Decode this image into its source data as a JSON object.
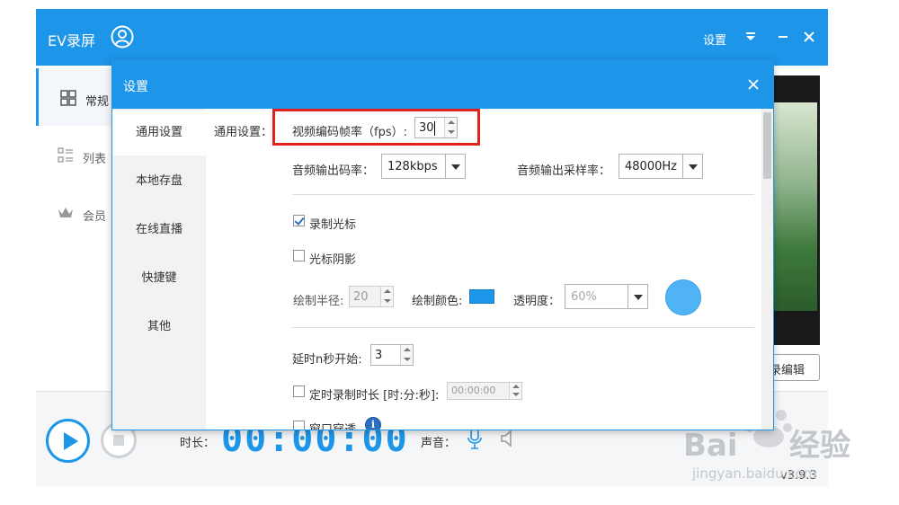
{
  "app": {
    "title": "EV录屏",
    "settings_label": "设置",
    "sidebar": [
      {
        "label": "常规",
        "icon": "grid-icon",
        "active": true
      },
      {
        "label": "列表",
        "icon": "list-icon",
        "active": false
      },
      {
        "label": "会员",
        "icon": "crown-icon",
        "active": false
      }
    ],
    "edit_button_label": "录编辑",
    "bottom": {
      "duration_label": "时长：",
      "duration_value": "00:00:00",
      "sound_label": "声音：",
      "version": "v3.9.3"
    }
  },
  "dialog": {
    "title": "设置",
    "nav": [
      "通用设置",
      "本地存盘",
      "在线直播",
      "快捷键",
      "其他"
    ],
    "active_nav": "通用设置",
    "section_label": "通用设置：",
    "fps": {
      "label": "视频编码帧率（fps）:",
      "value": "30"
    },
    "audio_bitrate": {
      "label": "音频输出码率：",
      "value": "128kbps"
    },
    "audio_samplerate": {
      "label": "音频输出采样率：",
      "value": "48000Hz"
    },
    "record_cursor": {
      "label": "录制光标",
      "checked": true
    },
    "cursor_shadow": {
      "label": "光标阴影",
      "checked": false
    },
    "draw_radius": {
      "label": "绘制半径:",
      "value": "20"
    },
    "draw_color": {
      "label": "绘制颜色:",
      "color": "#1d95e8"
    },
    "opacity": {
      "label": "透明度：",
      "value": "60%"
    },
    "delay_start": {
      "label": "延时n秒开始:",
      "value": "3"
    },
    "timed_record": {
      "label": "定时录制时长 [时:分:秒]:",
      "value": "00:00:00",
      "checked": false
    },
    "window_transparent": {
      "label": "窗口穿透",
      "checked": false
    }
  },
  "watermark": {
    "brand": "Bai du 经验",
    "url": "jingyan.baidu.com"
  },
  "colors": {
    "accent": "#1d95e8",
    "highlight": "#e0231c"
  }
}
